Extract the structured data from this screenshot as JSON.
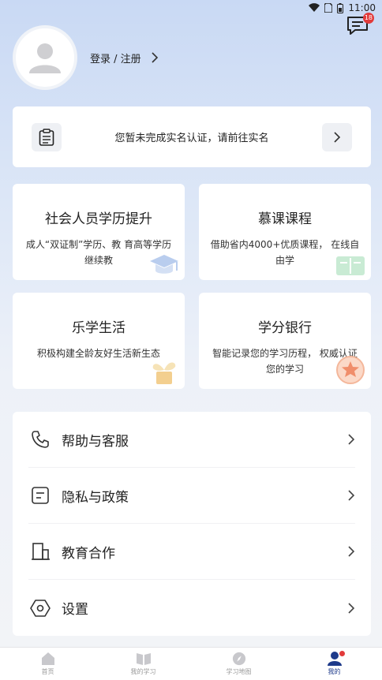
{
  "status_bar": {
    "time": "11:00"
  },
  "header": {
    "message_badge": "18"
  },
  "profile": {
    "login_label": "登录 / 注册"
  },
  "verify": {
    "text": "您暂未完成实名认证，请前往实名"
  },
  "tiles": [
    {
      "title": "社会人员学历提升",
      "desc": "成人“双证制”学历、教 育高等学历继续教"
    },
    {
      "title": "慕课课程",
      "desc": "借助省内4000+优质课程， 在线自由学"
    },
    {
      "title": "乐学生活",
      "desc": "积极构建全龄友好生活新生态"
    },
    {
      "title": "学分银行",
      "desc": "智能记录您的学习历程， 权威认证您的学习"
    }
  ],
  "menu": [
    {
      "label": "帮助与客服",
      "icon": "phone-icon"
    },
    {
      "label": "隐私与政策",
      "icon": "document-icon"
    },
    {
      "label": "教育合作",
      "icon": "building-icon"
    },
    {
      "label": "设置",
      "icon": "hexagon-settings-icon"
    }
  ],
  "tabbar": [
    {
      "label": "首页",
      "icon": "home-icon"
    },
    {
      "label": "我的学习",
      "icon": "book-icon"
    },
    {
      "label": "学习地图",
      "icon": "compass-icon"
    },
    {
      "label": "我的",
      "icon": "person-icon"
    }
  ],
  "colors": {
    "accent": "#1e3a8a",
    "badge": "#e23b3b"
  }
}
